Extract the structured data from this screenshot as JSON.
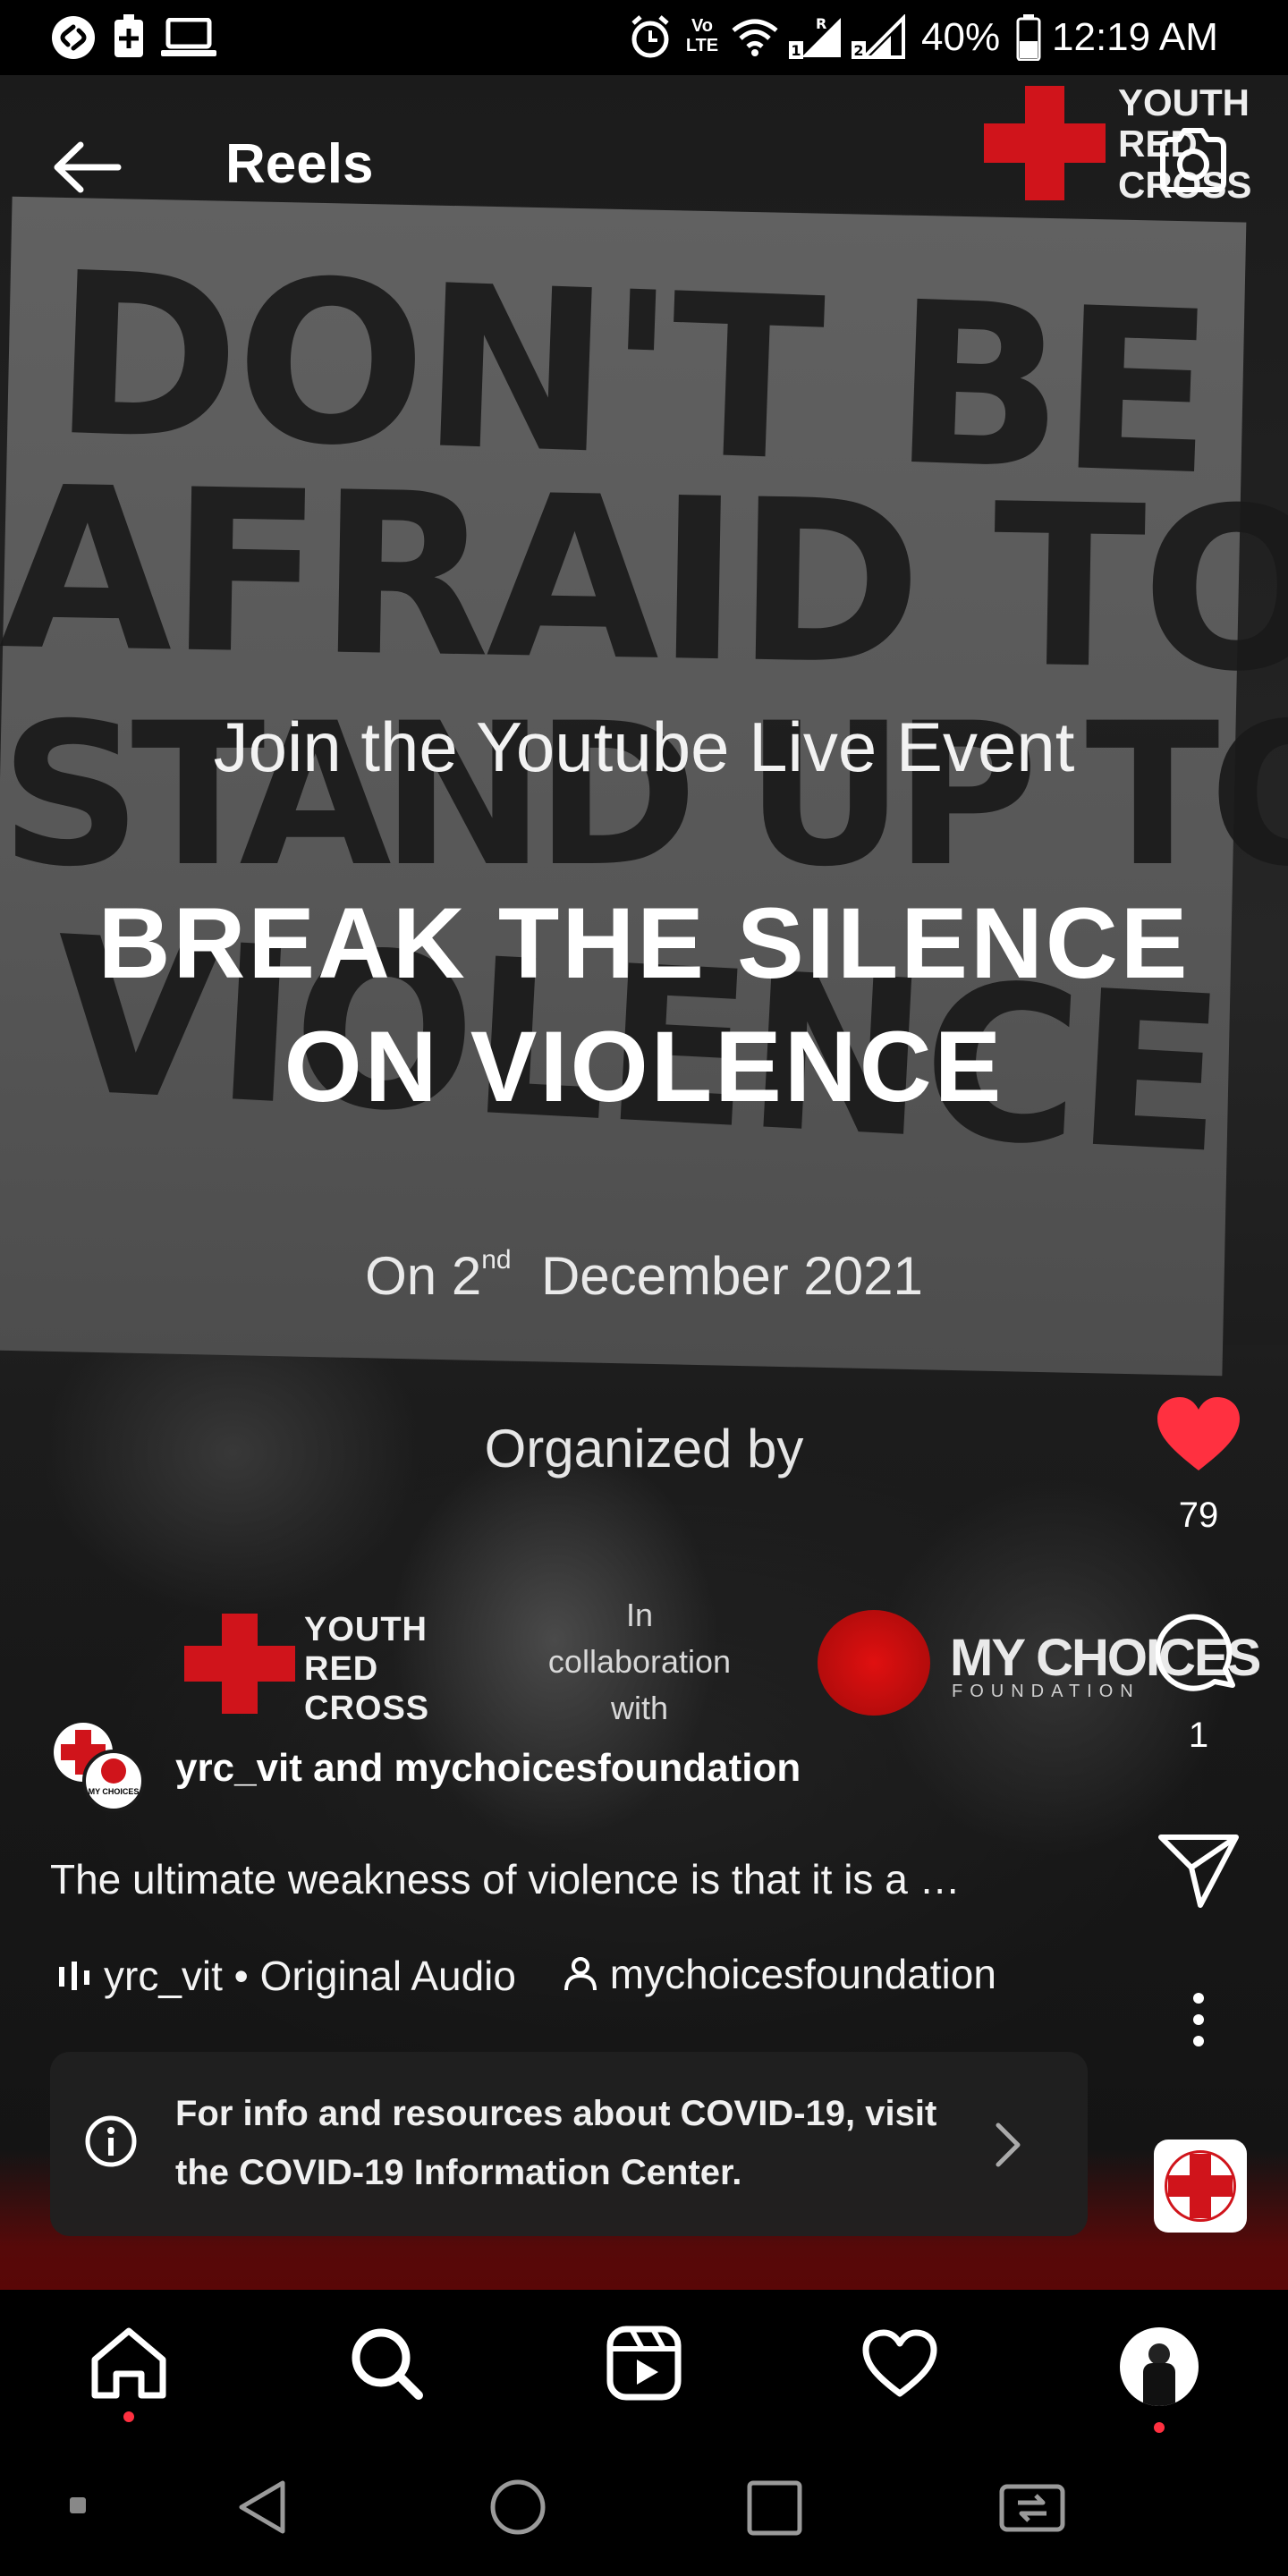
{
  "status_bar": {
    "network_label": "Vo LTE",
    "sim_labels": [
      "R",
      "1",
      "2"
    ],
    "battery": "40%",
    "time": "12:19 AM"
  },
  "header": {
    "title": "Reels"
  },
  "reel": {
    "placard_lines": [
      "DON'T BE",
      "AFRAID TO",
      "STAND UP TO",
      "VIOLENCE"
    ],
    "join_text": "Join the Youtube Live Event",
    "title_line1": "BREAK THE SILENCE",
    "title_line2": "ON VIOLENCE",
    "date_prefix": "On 2",
    "date_suffix_sup": "nd",
    "date_rest": "December 2021",
    "organized_by": "Organized by",
    "yrc_logo": [
      "YOUTH",
      "RED",
      "CROSS"
    ],
    "collab_text": [
      "In",
      "collaboration",
      "with"
    ],
    "mcf_name": "MY CHOICES",
    "mcf_sub": "FOUNDATION"
  },
  "top_logo": [
    "YOUTH",
    "RED",
    "CROSS"
  ],
  "actions": {
    "likes": "79",
    "comments": "1",
    "liked": true
  },
  "post": {
    "usernames": "yrc_vit and mychoicesfoundation",
    "avatar_small_text": "MY CHOICES",
    "caption": "The ultimate weakness of violence is that it is a …",
    "audio": "yrc_vit • Original Audio",
    "tagged": "mychoicesfoundation"
  },
  "covid_banner": {
    "line1": "For info and resources about COVID-19, visit",
    "line2": "the COVID-19 Information Center."
  },
  "bottom_nav": {
    "items": [
      "home-icon",
      "search-icon",
      "reels-icon",
      "activity-icon",
      "profile-avatar"
    ],
    "active": "home-icon"
  },
  "colors": {
    "brand_red": "#d0141b",
    "like_red": "#ff3040"
  }
}
